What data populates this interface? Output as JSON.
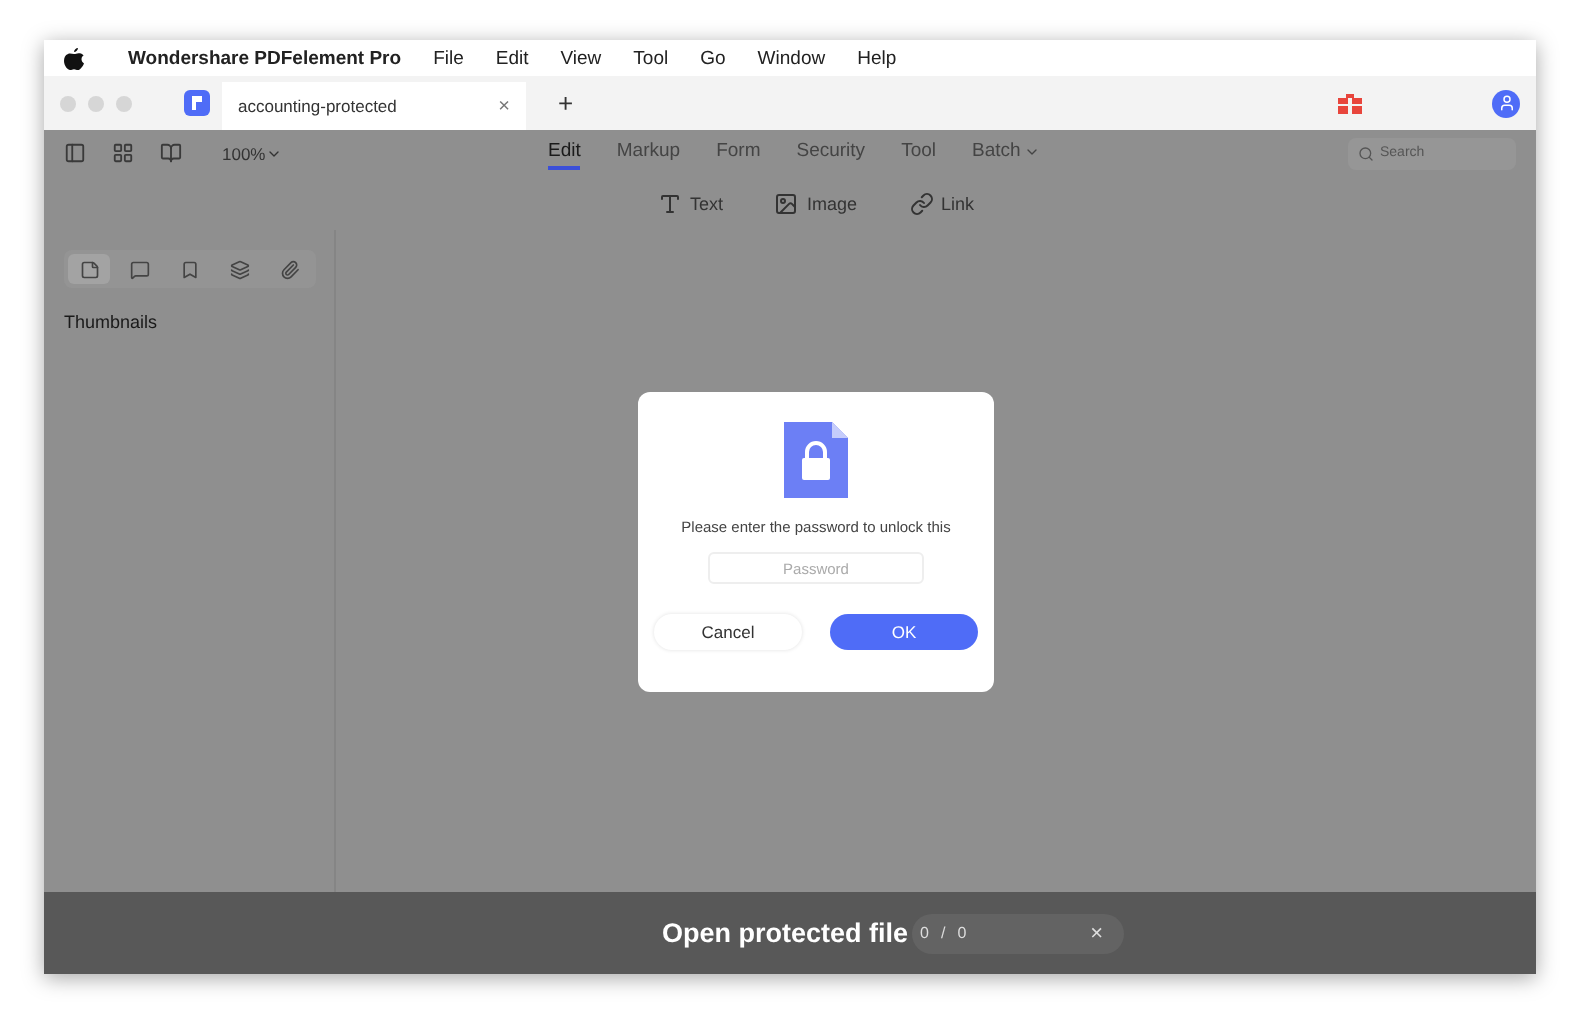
{
  "menu_bar": {
    "app_name": "Wondershare PDFelement Pro",
    "items": [
      "File",
      "Edit",
      "View",
      "Tool",
      "Go",
      "Window",
      "Help"
    ]
  },
  "document_tab": {
    "title": "accounting-protected",
    "close": "×",
    "new_tab": "+"
  },
  "toolbar": {
    "zoom": "100%",
    "tabs": [
      {
        "label": "Edit",
        "selected": true,
        "has_menu": false
      },
      {
        "label": "Markup",
        "selected": false,
        "has_menu": false
      },
      {
        "label": "Form",
        "selected": false,
        "has_menu": false
      },
      {
        "label": "Security",
        "selected": false,
        "has_menu": false
      },
      {
        "label": "Tool",
        "selected": false,
        "has_menu": false
      },
      {
        "label": "Batch",
        "selected": false,
        "has_menu": true
      }
    ],
    "search": {
      "placeholder": "Search"
    }
  },
  "edit_tools": [
    {
      "kind": "text",
      "label": "Text"
    },
    {
      "kind": "image",
      "label": "Image"
    },
    {
      "kind": "link",
      "label": "Link"
    }
  ],
  "sidebar": {
    "tabs": [
      {
        "kind": "thumbnail",
        "selected": true
      },
      {
        "kind": "comment",
        "selected": false
      },
      {
        "kind": "bookmark",
        "selected": false
      },
      {
        "kind": "layers",
        "selected": false
      },
      {
        "kind": "attachment",
        "selected": false
      }
    ],
    "heading": "Thumbnails"
  },
  "dialog": {
    "message": "Please enter the password to unlock this",
    "password": {
      "placeholder": "Password"
    },
    "buttons": [
      {
        "kind": "cancel",
        "label": "Cancel"
      },
      {
        "kind": "primary",
        "label": "OK"
      }
    ]
  },
  "page_nav": {
    "current": "0",
    "separator": "/",
    "total": "0",
    "close": "×"
  },
  "caption": "Open protected file"
}
